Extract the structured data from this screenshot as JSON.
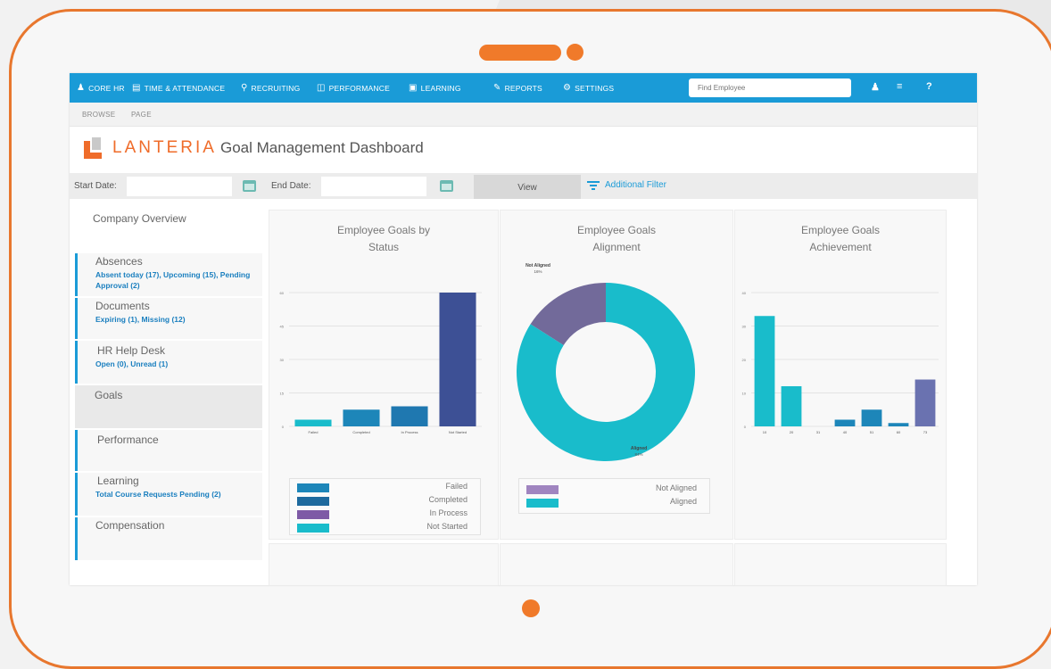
{
  "nav": {
    "items": [
      {
        "icon": "person-icon",
        "label": "CORE HR"
      },
      {
        "icon": "calendar-icon",
        "label": "TIME & ATTENDANCE"
      },
      {
        "icon": "search-icon",
        "label": "RECRUITING"
      },
      {
        "icon": "performance-icon",
        "label": "PERFORMANCE"
      },
      {
        "icon": "book-icon",
        "label": "LEARNING"
      },
      {
        "icon": "edit-icon",
        "label": "REPORTS"
      },
      {
        "icon": "gear-icon",
        "label": "SETTINGS"
      }
    ],
    "search_placeholder": "Find Employee"
  },
  "breadcrumb": {
    "browse": "BROWSE",
    "page": "PAGE"
  },
  "header": {
    "brand": "LANTERIA",
    "title": "Goal Management Dashboard"
  },
  "filters": {
    "start_label": "Start Date:",
    "end_label": "End Date:",
    "view_label": "View",
    "additional_filter": "Additional Filter"
  },
  "sidebar": {
    "items": [
      {
        "title": "Company Overview",
        "sub": ""
      },
      {
        "title": "Absences",
        "sub": "Absent today (17), Upcoming (15), Pending Approval (2)"
      },
      {
        "title": "Documents",
        "sub": "Expiring (1), Missing (12)"
      },
      {
        "title": "HR Help Desk",
        "sub": "Open (0), Unread (1)"
      },
      {
        "title": "Goals",
        "sub": ""
      },
      {
        "title": "Performance",
        "sub": ""
      },
      {
        "title": "Learning",
        "sub": "Total Course Requests Pending (2)"
      },
      {
        "title": "Compensation",
        "sub": ""
      }
    ]
  },
  "panels": {
    "status_title": "Employee Goals by Status",
    "alignment_title": "Employee Goals Alignment",
    "achievement_title": "Employee Goals Achievement"
  },
  "colors": {
    "nav": "#1a9bd7",
    "accent": "#ef6c2a",
    "teal": "#19bccb",
    "navy": "#3d5095",
    "purple": "#7e6aa0",
    "blue": "#1d86b9"
  },
  "chart_data": [
    {
      "type": "bar",
      "title": "Employee Goals by Status",
      "categories": [
        "Failed",
        "Completed",
        "In Process",
        "Not Started"
      ],
      "values": [
        3,
        7.5,
        9,
        60
      ],
      "ylim": [
        0,
        60
      ],
      "yticks": [
        "0",
        "15",
        "30",
        "45",
        "60"
      ],
      "legend": [
        "Failed",
        "Completed",
        "In Process",
        "Not Started"
      ],
      "legend_colors": [
        "#1d86b9",
        "#1e6a9e",
        "#7e5aa6",
        "#19bccb"
      ],
      "bar_colors": [
        "#19bccb",
        "#1d86b9",
        "#1f78b0",
        "#3d5095"
      ]
    },
    {
      "type": "pie",
      "title": "Employee Goals Alignment",
      "labels": [
        "Not Aligned",
        "Aligned"
      ],
      "values": [
        16,
        84
      ],
      "value_labels": [
        "16%",
        "84%"
      ],
      "colors": [
        "#726a9a",
        "#19bccb"
      ],
      "legend_colors": [
        "#a085c0",
        "#19bccb"
      ]
    },
    {
      "type": "bar",
      "title": "Employee Goals Achievement",
      "categories": [
        "10",
        "20",
        "31",
        "40",
        "51",
        "60",
        "73"
      ],
      "values": [
        33,
        12,
        0,
        2,
        5,
        1,
        14
      ],
      "ylim": [
        0,
        40
      ],
      "yticks": [
        "0",
        "10",
        "20",
        "30",
        "40"
      ],
      "bar_colors": [
        "#19bccb",
        "#19bccb",
        "#19bccb",
        "#1d86b9",
        "#1d86b9",
        "#1d86b9",
        "#6a72b0"
      ]
    }
  ]
}
